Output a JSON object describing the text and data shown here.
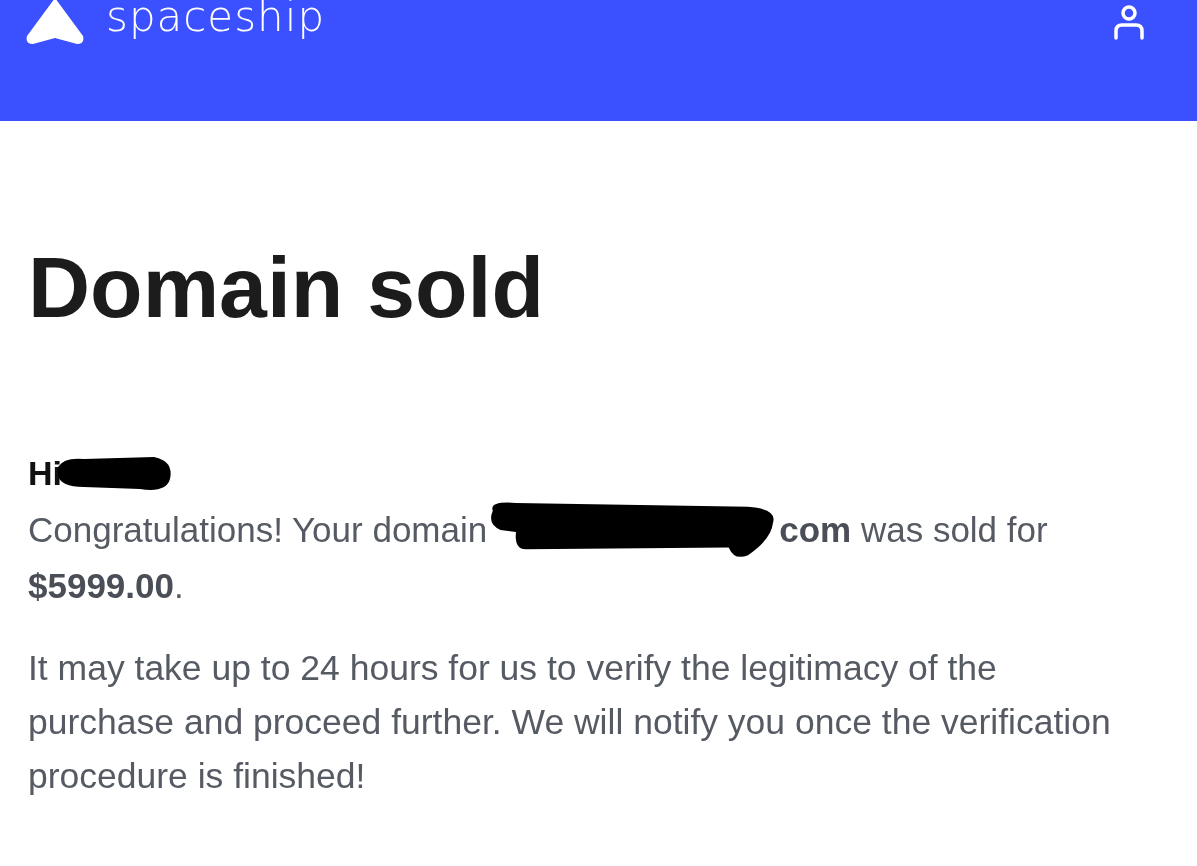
{
  "header": {
    "logo_text": "spaceship"
  },
  "title": "Domain sold",
  "greeting": "Hi",
  "sale_message": {
    "before": "Congratulations! Your domain",
    "after": "**com** was sold for",
    "amount": "**$5999.00**."
  },
  "note": "It may take up to 24 hours for us to verify the legitimacy of the purchase and proceed further. We will notify you once the verification procedure is finished!"
}
